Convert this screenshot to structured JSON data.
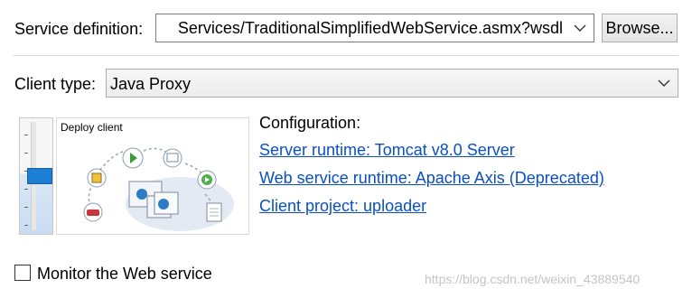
{
  "service": {
    "label": "Service definition:",
    "value": "Services/TraditionalSimplifiedWebService.asmx?wsdl",
    "browse_label": "Browse..."
  },
  "client": {
    "label": "Client type:",
    "value": "Java Proxy"
  },
  "slider": {
    "caption": "Deploy client",
    "level": 0.5
  },
  "configuration": {
    "heading": "Configuration:",
    "server_runtime": "Server runtime: Tomcat v8.0 Server",
    "ws_runtime": "Web service runtime: Apache Axis (Deprecated)",
    "client_project": "Client project: uploader"
  },
  "monitor": {
    "label": "Monitor the Web service",
    "checked": false
  },
  "watermark": "https://blog.csdn.net/weixin_43889540",
  "colors": {
    "link": "#0a4fc7",
    "slider_thumb": "#1e7fd6"
  }
}
